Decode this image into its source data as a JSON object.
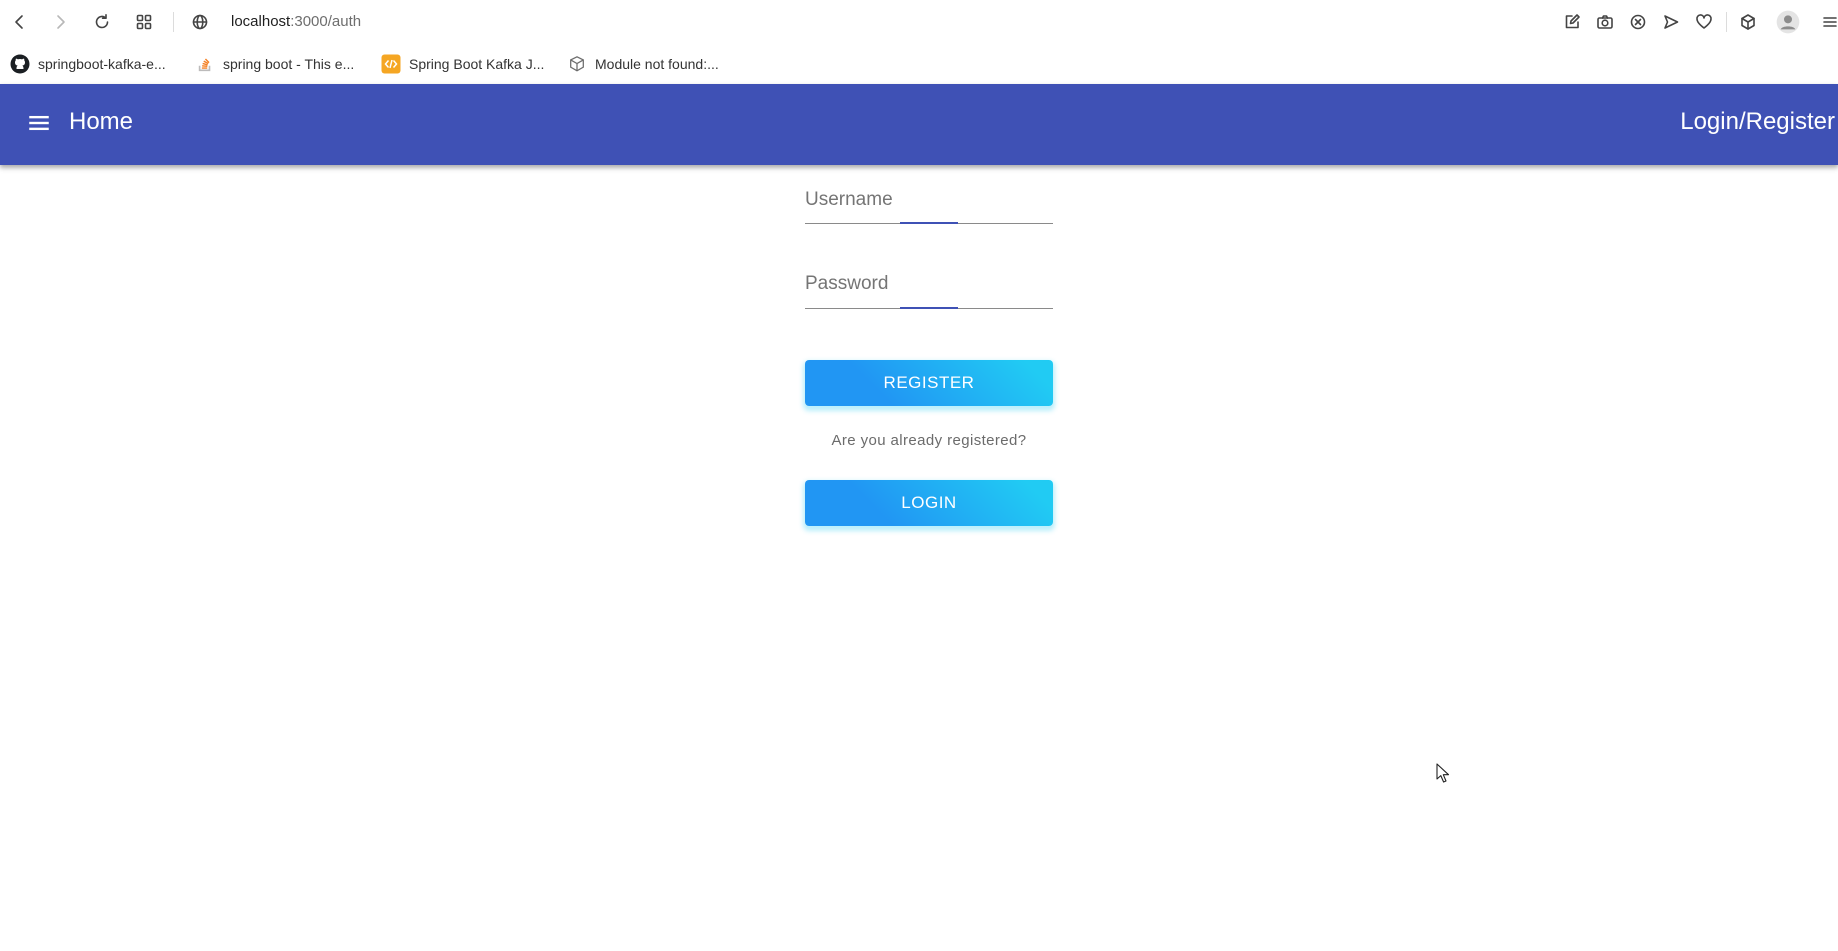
{
  "browser": {
    "url_host": "localhost",
    "url_path": ":3000/auth",
    "bookmarks": [
      {
        "label": "springboot-kafka-e...",
        "icon": "github-icon"
      },
      {
        "label": "spring boot - This e...",
        "icon": "stackoverflow-icon"
      },
      {
        "label": "Spring Boot Kafka J...",
        "icon": "code-icon",
        "color": "#f5a623"
      },
      {
        "label": "Module not found:...",
        "icon": "module-icon"
      }
    ]
  },
  "appbar": {
    "title": "Home",
    "login_link": "Login/Register",
    "color": "#3f51b5"
  },
  "form": {
    "username_label": "Username",
    "username_value": "",
    "password_label": "Password",
    "password_value": "",
    "register_label": "REGISTER",
    "hint_text": "Are you already registered?",
    "login_label": "LOGIN"
  }
}
